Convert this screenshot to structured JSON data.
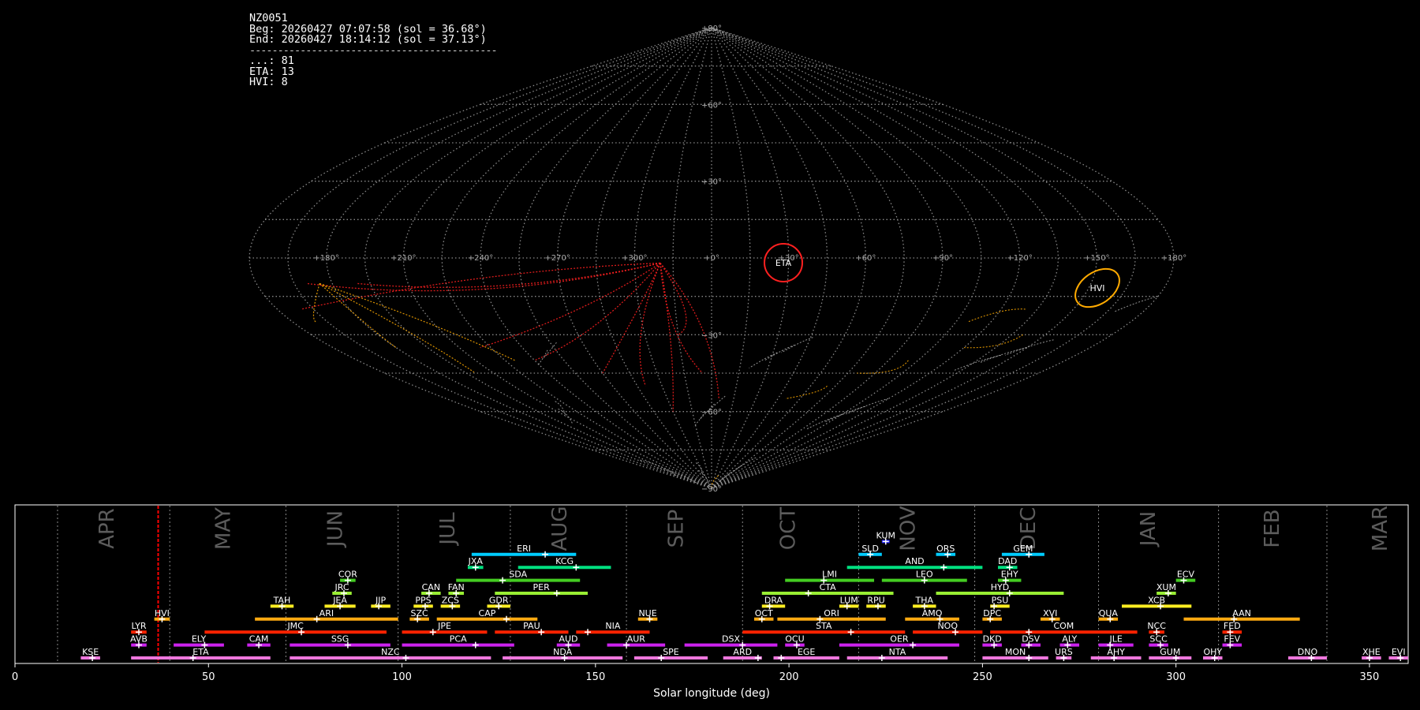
{
  "info": {
    "station": "NZ0051",
    "begin": "Beg: 20260427 07:07:58 (sol = 36.68°)",
    "end": "End: 20260427 18:14:12 (sol = 37.13°)",
    "separator": "--------------------------------------------",
    "counts": [
      "...: 81",
      "ETA: 13",
      "HVI: 8"
    ]
  },
  "colors": {
    "background": "#000000",
    "grid": "#888888",
    "eta": "#ff2020",
    "hvi": "#ffaa00",
    "sporadic": "#aaaaaa",
    "current_sol_line": "#ff0000"
  },
  "sky_map": {
    "projection": "sinusoidal",
    "lon_ticks": [
      "+180°",
      "+150°",
      "+120°",
      "+90°",
      "+60°",
      "+30°",
      "+0°",
      "+300°",
      "+270°",
      "+240°",
      "+210°",
      "+180°"
    ],
    "lat_ticks": [
      "+90°",
      "+60°",
      "+30°",
      "−30°",
      "−60°",
      "−90°"
    ],
    "radiants": [
      {
        "code": "ETA",
        "color": "#ff2020"
      },
      {
        "code": "HVI",
        "color": "#ffaa00"
      }
    ]
  },
  "chart_data": {
    "type": "timeline",
    "xlabel": "Solar longitude (deg)",
    "xlim": [
      0,
      360
    ],
    "xticks": [
      0,
      50,
      100,
      150,
      200,
      250,
      300,
      350
    ],
    "current_sol": 37,
    "months": [
      {
        "name": "APR",
        "boundary": 11,
        "center": 24
      },
      {
        "name": "MAY",
        "boundary": 40,
        "center": 54
      },
      {
        "name": "JUN",
        "boundary": 70,
        "center": 83
      },
      {
        "name": "JUL",
        "boundary": 99,
        "center": 112
      },
      {
        "name": "AUG",
        "boundary": 128,
        "center": 141
      },
      {
        "name": "SEP",
        "boundary": 158,
        "center": 171
      },
      {
        "name": "OCT",
        "boundary": 188,
        "center": 200
      },
      {
        "name": "NOV",
        "boundary": 218,
        "center": 231
      },
      {
        "name": "DEC",
        "boundary": 248,
        "center": 262
      },
      {
        "name": "JAN",
        "boundary": 280,
        "center": 293
      },
      {
        "name": "FEB",
        "boundary": 311,
        "center": 325
      },
      {
        "name": "MAR",
        "boundary": 339,
        "center": 353
      }
    ],
    "showers": [
      {
        "code": "KUM",
        "start": 224,
        "end": 226,
        "peak": 225,
        "row": 10,
        "color": "#2222ff"
      },
      {
        "code": "ERI",
        "start": 118,
        "end": 145,
        "peak": 137,
        "row": 9,
        "color": "#00ccff"
      },
      {
        "code": "SLD",
        "start": 218,
        "end": 224,
        "peak": 221,
        "row": 9,
        "color": "#00ccff"
      },
      {
        "code": "ORS",
        "start": 238,
        "end": 243,
        "peak": 241,
        "row": 9,
        "color": "#00ccff"
      },
      {
        "code": "GEM",
        "start": 255,
        "end": 266,
        "peak": 262,
        "row": 9,
        "color": "#00ccff"
      },
      {
        "code": "JXA",
        "start": 117,
        "end": 121,
        "peak": 119,
        "row": 8,
        "color": "#00e080"
      },
      {
        "code": "KCG",
        "start": 130,
        "end": 154,
        "peak": 145,
        "row": 8,
        "color": "#00e080"
      },
      {
        "code": "AND",
        "start": 215,
        "end": 250,
        "peak": 240,
        "row": 8,
        "color": "#00e080"
      },
      {
        "code": "DAD",
        "start": 254,
        "end": 259,
        "peak": 257,
        "row": 8,
        "color": "#00e080"
      },
      {
        "code": "COR",
        "start": 84,
        "end": 88,
        "peak": 86,
        "row": 7,
        "color": "#44cc22"
      },
      {
        "code": "SDA",
        "start": 114,
        "end": 146,
        "peak": 126,
        "row": 7,
        "color": "#44cc22"
      },
      {
        "code": "LMI",
        "start": 199,
        "end": 222,
        "peak": 209,
        "row": 7,
        "color": "#44cc22"
      },
      {
        "code": "LEO",
        "start": 224,
        "end": 246,
        "peak": 235,
        "row": 7,
        "color": "#44cc22"
      },
      {
        "code": "EHY",
        "start": 254,
        "end": 260,
        "peak": 256,
        "row": 7,
        "color": "#44cc22"
      },
      {
        "code": "ECV",
        "start": 300,
        "end": 305,
        "peak": 302,
        "row": 7,
        "color": "#44cc22"
      },
      {
        "code": "JRC",
        "start": 82,
        "end": 87,
        "peak": 85,
        "row": 6,
        "color": "#99ee33"
      },
      {
        "code": "CAN",
        "start": 105,
        "end": 110,
        "peak": 107,
        "row": 6,
        "color": "#99ee33"
      },
      {
        "code": "FAN",
        "start": 112,
        "end": 116,
        "peak": 114,
        "row": 6,
        "color": "#99ee33"
      },
      {
        "code": "PER",
        "start": 124,
        "end": 148,
        "peak": 140,
        "row": 6,
        "color": "#99ee33"
      },
      {
        "code": "CTA",
        "start": 193,
        "end": 227,
        "peak": 205,
        "row": 6,
        "color": "#99ee33"
      },
      {
        "code": "HYD",
        "start": 238,
        "end": 271,
        "peak": 257,
        "row": 6,
        "color": "#99ee33"
      },
      {
        "code": "XUM",
        "start": 295,
        "end": 300,
        "peak": 298,
        "row": 6,
        "color": "#99ee33"
      },
      {
        "code": "TAH",
        "start": 66,
        "end": 72,
        "peak": 69,
        "row": 5,
        "color": "#ffee22"
      },
      {
        "code": "JEA",
        "start": 80,
        "end": 88,
        "peak": 84,
        "row": 5,
        "color": "#ffee22"
      },
      {
        "code": "JIP",
        "start": 92,
        "end": 97,
        "peak": 94,
        "row": 5,
        "color": "#ffee22"
      },
      {
        "code": "PPS",
        "start": 103,
        "end": 108,
        "peak": 106,
        "row": 5,
        "color": "#ffee22"
      },
      {
        "code": "ZCS",
        "start": 110,
        "end": 115,
        "peak": 113,
        "row": 5,
        "color": "#ffee22"
      },
      {
        "code": "GDR",
        "start": 122,
        "end": 128,
        "peak": 125,
        "row": 5,
        "color": "#ffee22"
      },
      {
        "code": "DRA",
        "start": 193,
        "end": 199,
        "peak": 195,
        "row": 5,
        "color": "#ffee22"
      },
      {
        "code": "LUM",
        "start": 213,
        "end": 218,
        "peak": 215,
        "row": 5,
        "color": "#ffee22"
      },
      {
        "code": "RPU",
        "start": 220,
        "end": 225,
        "peak": 223,
        "row": 5,
        "color": "#ffee22"
      },
      {
        "code": "THA",
        "start": 232,
        "end": 238,
        "peak": 235,
        "row": 5,
        "color": "#ffee22"
      },
      {
        "code": "PSU",
        "start": 252,
        "end": 257,
        "peak": 253,
        "row": 5,
        "color": "#ffee22"
      },
      {
        "code": "XCB",
        "start": 286,
        "end": 304,
        "peak": 296,
        "row": 5,
        "color": "#ffee22"
      },
      {
        "code": "ARI",
        "start": 62,
        "end": 99,
        "peak": 78,
        "row": 4,
        "color": "#ffaa11"
      },
      {
        "code": "SZC",
        "start": 102,
        "end": 107,
        "peak": 104,
        "row": 4,
        "color": "#ffaa11"
      },
      {
        "code": "CAP",
        "start": 109,
        "end": 135,
        "peak": 127,
        "row": 4,
        "color": "#ffaa11"
      },
      {
        "code": "NUE",
        "start": 161,
        "end": 166,
        "peak": 164,
        "row": 4,
        "color": "#ffaa11"
      },
      {
        "code": "OCT",
        "start": 191,
        "end": 196,
        "peak": 193,
        "row": 4,
        "color": "#ffaa11"
      },
      {
        "code": "ORI",
        "start": 197,
        "end": 225,
        "peak": 208,
        "row": 4,
        "color": "#ffaa11"
      },
      {
        "code": "AMO",
        "start": 230,
        "end": 244,
        "peak": 239,
        "row": 4,
        "color": "#ffaa11"
      },
      {
        "code": "DPC",
        "start": 250,
        "end": 255,
        "peak": 252,
        "row": 4,
        "color": "#ffaa11"
      },
      {
        "code": "XVI",
        "start": 265,
        "end": 270,
        "peak": 268,
        "row": 4,
        "color": "#ffaa11"
      },
      {
        "code": "QUA",
        "start": 280,
        "end": 285,
        "peak": 283,
        "row": 4,
        "color": "#ffaa11"
      },
      {
        "code": "AAN",
        "start": 302,
        "end": 332,
        "peak": 315,
        "row": 4,
        "color": "#ffaa11"
      },
      {
        "code": "HVI",
        "start": 36,
        "end": 40,
        "peak": 38,
        "row": 4,
        "color": "#ffaa11"
      },
      {
        "code": "LYR",
        "start": 30,
        "end": 34,
        "peak": 32,
        "row": 3,
        "color": "#ff2200"
      },
      {
        "code": "JMC",
        "start": 49,
        "end": 96,
        "peak": 74,
        "row": 3,
        "color": "#ff2200"
      },
      {
        "code": "JPE",
        "start": 100,
        "end": 122,
        "peak": 108,
        "row": 3,
        "color": "#ff2200"
      },
      {
        "code": "PAU",
        "start": 124,
        "end": 143,
        "peak": 136,
        "row": 3,
        "color": "#ff2200"
      },
      {
        "code": "NIA",
        "start": 145,
        "end": 164,
        "peak": 148,
        "row": 3,
        "color": "#ff2200"
      },
      {
        "code": "STA",
        "start": 188,
        "end": 230,
        "peak": 216,
        "row": 3,
        "color": "#ff2200"
      },
      {
        "code": "NOO",
        "start": 232,
        "end": 250,
        "peak": 243,
        "row": 3,
        "color": "#ff2200"
      },
      {
        "code": "COM",
        "start": 252,
        "end": 290,
        "peak": 262,
        "row": 3,
        "color": "#ff2200"
      },
      {
        "code": "NCC",
        "start": 293,
        "end": 297,
        "peak": 295,
        "row": 3,
        "color": "#ff2200"
      },
      {
        "code": "FED",
        "start": 312,
        "end": 317,
        "peak": 314,
        "row": 3,
        "color": "#ff2200"
      },
      {
        "code": "AVB",
        "start": 30,
        "end": 34,
        "peak": 32,
        "row": 2,
        "color": "#cc22ee"
      },
      {
        "code": "ELY",
        "start": 41,
        "end": 54,
        "peak": 49,
        "row": 2,
        "color": "#cc22ee"
      },
      {
        "code": "CAM",
        "start": 60,
        "end": 66,
        "peak": 63,
        "row": 2,
        "color": "#cc22ee"
      },
      {
        "code": "SSG",
        "start": 71,
        "end": 97,
        "peak": 86,
        "row": 2,
        "color": "#cc22ee"
      },
      {
        "code": "PCA",
        "start": 100,
        "end": 129,
        "peak": 119,
        "row": 2,
        "color": "#cc22ee"
      },
      {
        "code": "AUD",
        "start": 140,
        "end": 146,
        "peak": 143,
        "row": 2,
        "color": "#cc22ee"
      },
      {
        "code": "AUR",
        "start": 153,
        "end": 168,
        "peak": 158,
        "row": 2,
        "color": "#cc22ee"
      },
      {
        "code": "DSX",
        "start": 173,
        "end": 197,
        "peak": 188,
        "row": 2,
        "color": "#cc22ee"
      },
      {
        "code": "OCU",
        "start": 199,
        "end": 204,
        "peak": 202,
        "row": 2,
        "color": "#cc22ee"
      },
      {
        "code": "OER",
        "start": 213,
        "end": 244,
        "peak": 232,
        "row": 2,
        "color": "#cc22ee"
      },
      {
        "code": "DKD",
        "start": 250,
        "end": 255,
        "peak": 253,
        "row": 2,
        "color": "#cc22ee"
      },
      {
        "code": "DSV",
        "start": 260,
        "end": 265,
        "peak": 262,
        "row": 2,
        "color": "#cc22ee"
      },
      {
        "code": "ALY",
        "start": 270,
        "end": 275,
        "peak": 272,
        "row": 2,
        "color": "#cc22ee"
      },
      {
        "code": "JLE",
        "start": 280,
        "end": 289,
        "peak": 283,
        "row": 2,
        "color": "#cc22ee"
      },
      {
        "code": "SCC",
        "start": 293,
        "end": 298,
        "peak": 296,
        "row": 2,
        "color": "#cc22ee"
      },
      {
        "code": "FEV",
        "start": 312,
        "end": 317,
        "peak": 314,
        "row": 2,
        "color": "#cc22ee"
      },
      {
        "code": "KSE",
        "start": 17,
        "end": 22,
        "peak": 20,
        "row": 1,
        "color": "#ee77dd"
      },
      {
        "code": "ETA",
        "start": 30,
        "end": 66,
        "peak": 46,
        "row": 1,
        "color": "#ee77dd"
      },
      {
        "code": "NZC",
        "start": 71,
        "end": 123,
        "peak": 101,
        "row": 1,
        "color": "#ee77dd"
      },
      {
        "code": "NDA",
        "start": 126,
        "end": 157,
        "peak": 142,
        "row": 1,
        "color": "#ee77dd"
      },
      {
        "code": "SPE",
        "start": 160,
        "end": 179,
        "peak": 167,
        "row": 1,
        "color": "#ee77dd"
      },
      {
        "code": "ARD",
        "start": 183,
        "end": 193,
        "peak": 192,
        "row": 1,
        "color": "#ee77dd"
      },
      {
        "code": "EGE",
        "start": 196,
        "end": 213,
        "peak": 198,
        "row": 1,
        "color": "#ee77dd"
      },
      {
        "code": "NTA",
        "start": 215,
        "end": 241,
        "peak": 224,
        "row": 1,
        "color": "#ee77dd"
      },
      {
        "code": "MON",
        "start": 250,
        "end": 267,
        "peak": 262,
        "row": 1,
        "color": "#ee77dd"
      },
      {
        "code": "URS",
        "start": 269,
        "end": 273,
        "peak": 271,
        "row": 1,
        "color": "#ee77dd"
      },
      {
        "code": "AHY",
        "start": 278,
        "end": 291,
        "peak": 284,
        "row": 1,
        "color": "#ee77dd"
      },
      {
        "code": "GUM",
        "start": 293,
        "end": 304,
        "peak": 300,
        "row": 1,
        "color": "#ee77dd"
      },
      {
        "code": "OHY",
        "start": 307,
        "end": 312,
        "peak": 310,
        "row": 1,
        "color": "#ee77dd"
      },
      {
        "code": "DNO",
        "start": 329,
        "end": 339,
        "peak": 335,
        "row": 1,
        "color": "#ee77dd"
      },
      {
        "code": "XHE",
        "start": 348,
        "end": 353,
        "peak": 350,
        "row": 1,
        "color": "#ee77dd"
      },
      {
        "code": "EVI",
        "start": 355,
        "end": 360,
        "peak": 358,
        "row": 1,
        "color": "#ee77dd"
      }
    ]
  }
}
